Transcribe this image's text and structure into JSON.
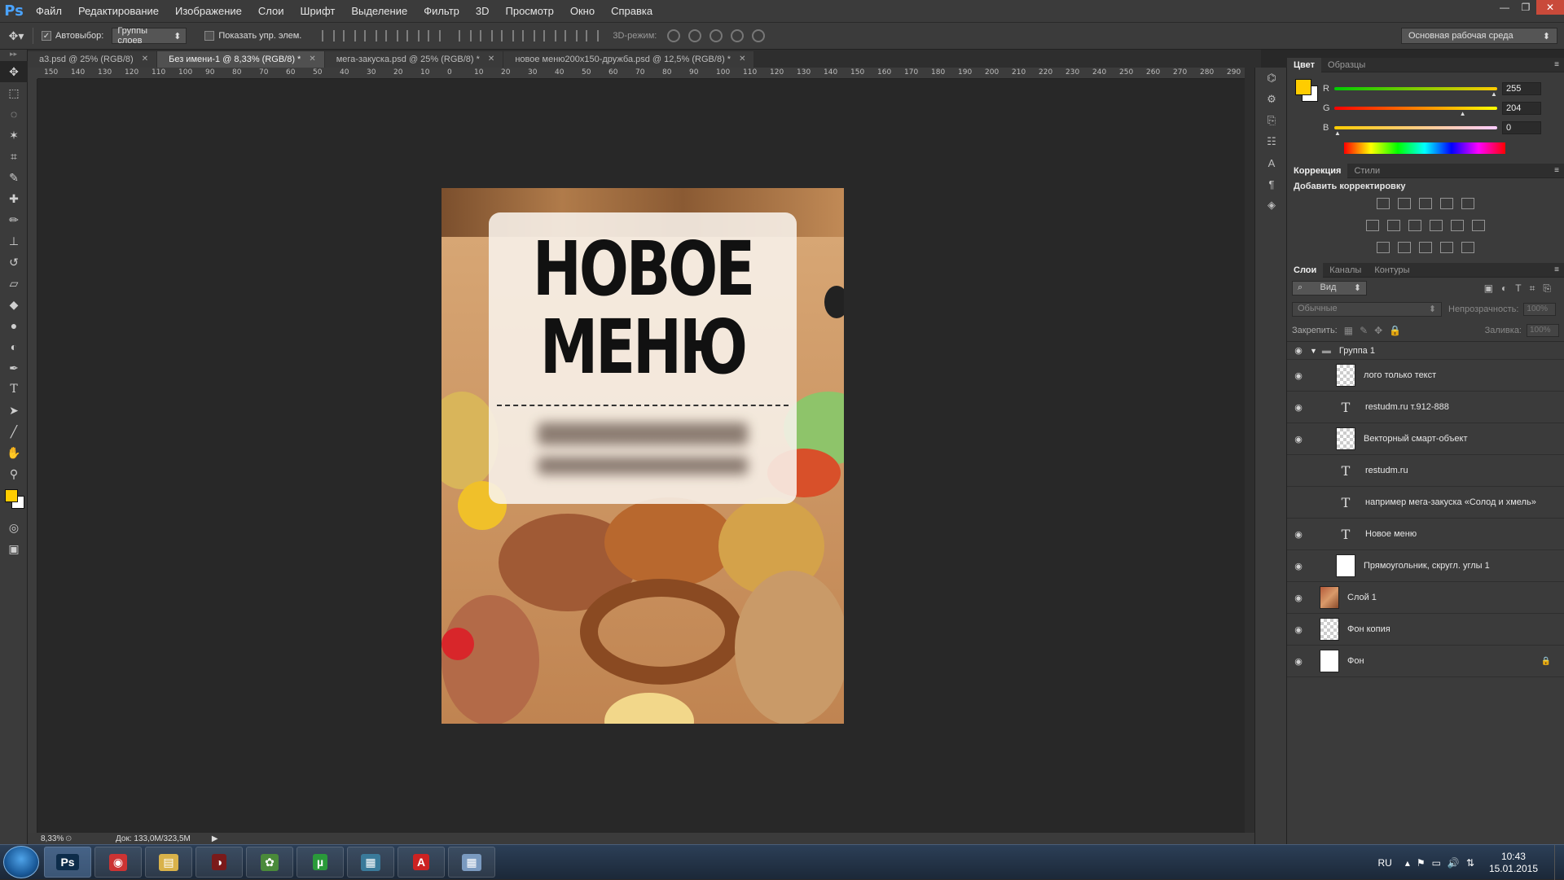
{
  "app": {
    "logo": "Ps"
  },
  "menubar": {
    "items": [
      "Файл",
      "Редактирование",
      "Изображение",
      "Слои",
      "Шрифт",
      "Выделение",
      "Фильтр",
      "3D",
      "Просмотр",
      "Окно",
      "Справка"
    ]
  },
  "options": {
    "autoselect_label": "Автовыбор:",
    "autoselect_value": "Группы слоев",
    "show_transform_label": "Показать упр. элем.",
    "mode3d_label": "3D-режим:",
    "workspace": "Основная рабочая среда"
  },
  "tabs": [
    {
      "label": "a3.psd @ 25% (RGB/8)",
      "active": false
    },
    {
      "label": "Без имени-1 @ 8,33% (RGB/8) *",
      "active": true
    },
    {
      "label": "мега-закуска.psd @ 25% (RGB/8) *",
      "active": false
    },
    {
      "label": "новое меню200х150-дружба.psd @ 12,5% (RGB/8) *",
      "active": false
    }
  ],
  "ruler": {
    "h_ticks": [
      "150",
      "140",
      "130",
      "120",
      "110",
      "100",
      "90",
      "80",
      "70",
      "60",
      "50",
      "40",
      "30",
      "20",
      "10",
      "0",
      "10",
      "20",
      "30",
      "40",
      "50",
      "60",
      "70",
      "80",
      "90",
      "100",
      "110",
      "120",
      "130",
      "140",
      "150",
      "160",
      "170",
      "180",
      "190",
      "200",
      "210",
      "220",
      "230",
      "240",
      "250",
      "260",
      "270",
      "280",
      "290"
    ]
  },
  "document": {
    "headline_line1": "НОВОЕ",
    "headline_line2": "МЕНЮ"
  },
  "color_panel": {
    "tabs": [
      "Цвет",
      "Образцы"
    ],
    "r_label": "R",
    "r_value": "255",
    "r_pct": 1.0,
    "g_label": "G",
    "g_value": "204",
    "g_pct": 0.8,
    "b_label": "B",
    "b_value": "0",
    "b_pct": 0.0,
    "foreground": "#ffcc00",
    "background": "#ffffff"
  },
  "correction_panel": {
    "tabs": [
      "Коррекция",
      "Стили"
    ],
    "title": "Добавить корректировку"
  },
  "layers_panel": {
    "tabs": [
      "Слои",
      "Каналы",
      "Контуры"
    ],
    "filter_label": "Вид",
    "blend_mode": "Обычные",
    "opacity_label": "Непрозрачность:",
    "opacity_value": "100%",
    "lock_label": "Закрепить:",
    "fill_label": "Заливка:",
    "fill_value": "100%",
    "layers": [
      {
        "name": "Группа 1",
        "kind": "group",
        "visible": true
      },
      {
        "name": "лого только текст",
        "kind": "smart",
        "visible": true
      },
      {
        "name": "restudm.ru    т.912-888",
        "kind": "text",
        "visible": true
      },
      {
        "name": "Векторный смарт-объект",
        "kind": "smart",
        "visible": true
      },
      {
        "name": "restudm.ru",
        "kind": "text",
        "visible": false
      },
      {
        "name": "например мега-закуска «Солод и хмель»",
        "kind": "text",
        "visible": false
      },
      {
        "name": "Новое меню",
        "kind": "text",
        "visible": true
      },
      {
        "name": "Прямоугольник, скругл. углы 1",
        "kind": "shape",
        "visible": true
      },
      {
        "name": "Слой 1",
        "kind": "photo",
        "visible": true
      },
      {
        "name": "Фон копия",
        "kind": "checker",
        "visible": true
      },
      {
        "name": "Фон",
        "kind": "white",
        "visible": true
      }
    ]
  },
  "statusbar": {
    "zoom": "8,33%",
    "doc": "Док: 133,0M/323,5M"
  },
  "taskbar": {
    "apps": [
      "Ps",
      "Chrome",
      "Files",
      "Media",
      "Paint",
      "uTorrent",
      "Tool",
      "Acrobat",
      "Calc"
    ],
    "lang": "RU",
    "time": "10:43",
    "date": "15.01.2015"
  }
}
